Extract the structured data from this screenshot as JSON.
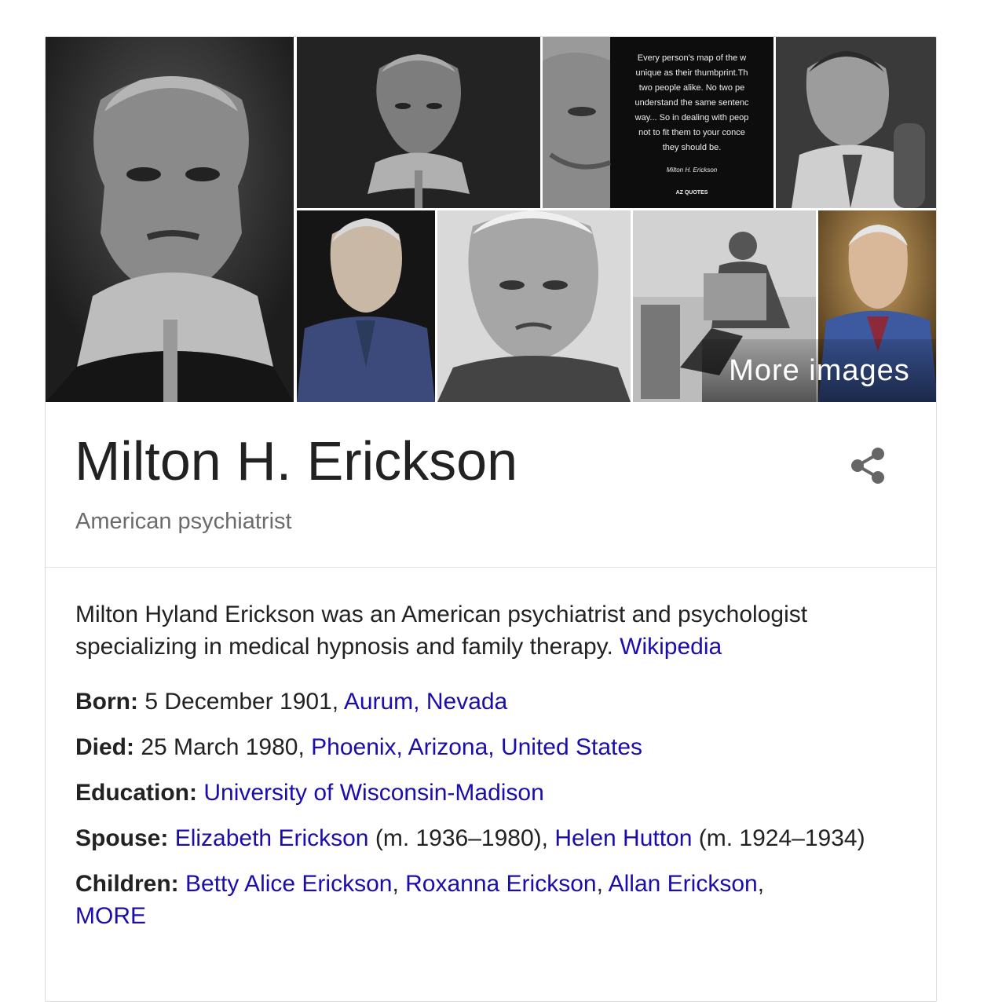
{
  "images": {
    "more_images_label": "More images",
    "quote_lines": [
      "Every person's map of the w",
      "unique as their thumbprint.Th",
      "two people alike. No two pe",
      "understand the same sentenc",
      "way... So in dealing with peop",
      "not to fit them to your conce",
      "they should be."
    ],
    "quote_signature": "Milton H. Erickson",
    "quote_brand": "AZ QUOTES"
  },
  "entity": {
    "title": "Milton H. Erickson",
    "subtitle": "American psychiatrist",
    "share_icon": "share-icon"
  },
  "description": {
    "text": "Milton Hyland Erickson was an American psychiatrist and psychologist specializing in medical hypnosis and family therapy. ",
    "source": "Wikipedia"
  },
  "facts": {
    "born": {
      "label": "Born:",
      "text": " 5 December 1901, ",
      "link": "Aurum, Nevada"
    },
    "died": {
      "label": "Died:",
      "text": " 25 March 1980, ",
      "link": "Phoenix, Arizona, United States"
    },
    "education": {
      "label": "Education:",
      "link": "University of Wisconsin-Madison"
    },
    "spouse": {
      "label": "Spouse:",
      "link1": "Elizabeth Erickson",
      "text1": " (m. 1936–1980), ",
      "link2": "Helen Hutton",
      "text2": " (m. 1924–1934)"
    },
    "children": {
      "label": "Children:",
      "link1": "Betty Alice Erickson",
      "sep1": ", ",
      "link2": "Roxanna Erickson",
      "sep2": ", ",
      "link3": "Allan Erickson",
      "sep3": ", ",
      "more": "MORE"
    }
  }
}
